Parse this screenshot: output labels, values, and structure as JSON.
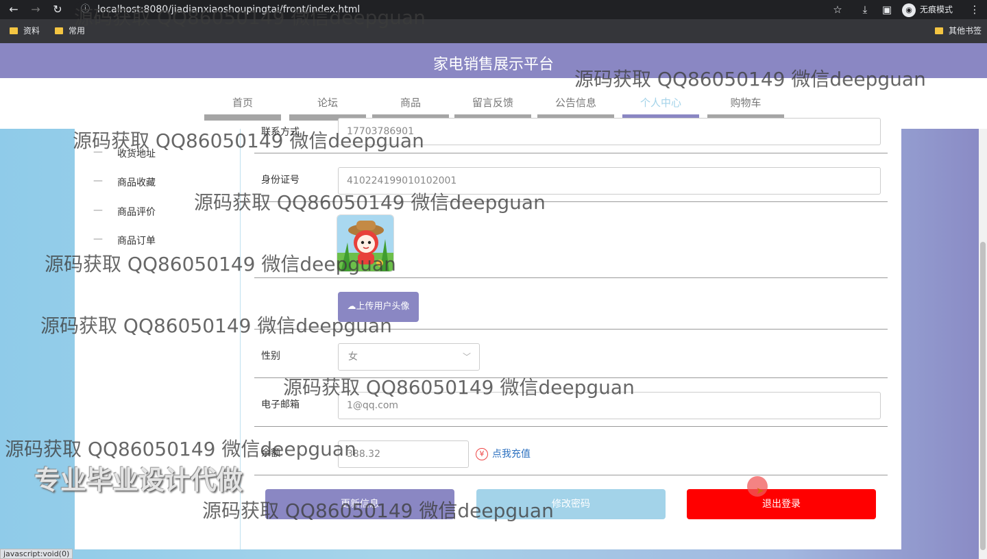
{
  "browser": {
    "url": "localhost:8080/jiadianxiaoshoupingtai/front/index.html",
    "incognito_label": "无痕模式",
    "bookmarks": [
      "资料",
      "常用"
    ],
    "other_bookmarks": "其他书签",
    "status_text": "javascript:void(0)"
  },
  "site": {
    "title": "家电销售展示平台",
    "nav": [
      {
        "label": "首页"
      },
      {
        "label": "论坛"
      },
      {
        "label": "商品"
      },
      {
        "label": "留言反馈"
      },
      {
        "label": "公告信息"
      },
      {
        "label": "个人中心",
        "active": true
      },
      {
        "label": "购物车"
      }
    ]
  },
  "sidebar": {
    "items": [
      {
        "label": "收货地址"
      },
      {
        "label": "商品收藏"
      },
      {
        "label": "商品评价"
      },
      {
        "label": "商品订单"
      }
    ]
  },
  "form": {
    "phone_label": "联系方式",
    "phone_value": "17703786901",
    "idcard_label": "身份证号",
    "idcard_value": "410224199010102001",
    "upload_label": "上传用户头像",
    "gender_label": "性别",
    "gender_value": "女",
    "email_label": "电子邮箱",
    "email_value": "1@qq.com",
    "balance_label": "余额",
    "balance_value": "388.32",
    "recharge_label": "点我充值",
    "yen_symbol": "¥"
  },
  "actions": {
    "update": "更新信息",
    "change_password": "修改密码",
    "logout": "退出登录"
  },
  "watermark": {
    "text": "源码获取 QQ86050149 微信deepguan",
    "big_text": "专业毕业设计代做"
  },
  "colors": {
    "primary": "#8a87c3",
    "secondary": "#a3d3e9",
    "danger": "#ff0000"
  }
}
